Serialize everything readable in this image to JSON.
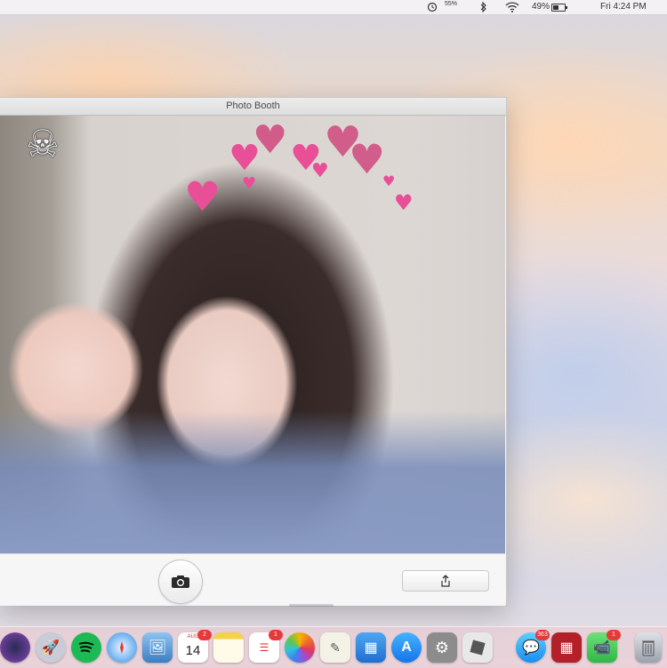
{
  "menubar": {
    "battery_pct_small": "55%",
    "wifi_battery": "49%",
    "clock": "Fri 4:24 PM",
    "icons": [
      "timemachine-icon",
      "bluetooth-icon",
      "wifi-icon",
      "battery-icon"
    ]
  },
  "window": {
    "title": "Photo Booth",
    "effects": {
      "stickers": [
        "skull-icon",
        "heart-icon"
      ]
    },
    "shutter_icon": "camera-icon",
    "share_icon": "share-icon"
  },
  "dock": {
    "calendar": {
      "month": "AUG",
      "day": "14",
      "badge": "2"
    },
    "reminders_badge": "1",
    "messages_badge": "363",
    "facetime_badge": "1",
    "apps": [
      "siri-icon",
      "launchpad-icon",
      "spotify-icon",
      "safari-icon",
      "preview-icon",
      "calendar-icon",
      "notes-icon",
      "reminders-icon",
      "photos-icon",
      "textedit-icon",
      "keynote-icon",
      "appstore-icon",
      "system-preferences-icon",
      "roblox-icon",
      "messages-icon",
      "photobooth-icon",
      "facetime-icon",
      "trash-icon"
    ]
  },
  "colors": {
    "heart": "#e84f97",
    "badge": "#e5393a"
  }
}
